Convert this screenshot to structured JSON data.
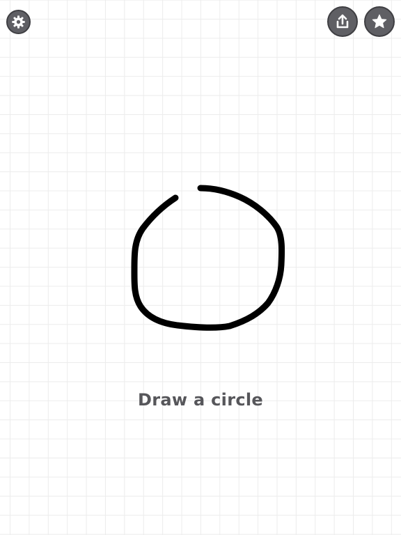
{
  "toolbar": {
    "settings_icon": "gear-icon",
    "share_icon": "share-upload-icon",
    "favorite_icon": "star-icon"
  },
  "prompt": {
    "text": "Draw a circle"
  },
  "colors": {
    "button_fill": "#5f5f64",
    "button_border": "#3e3e42",
    "stroke": "#000000",
    "prompt_text": "#56565a",
    "grid_line": "#ececec"
  }
}
